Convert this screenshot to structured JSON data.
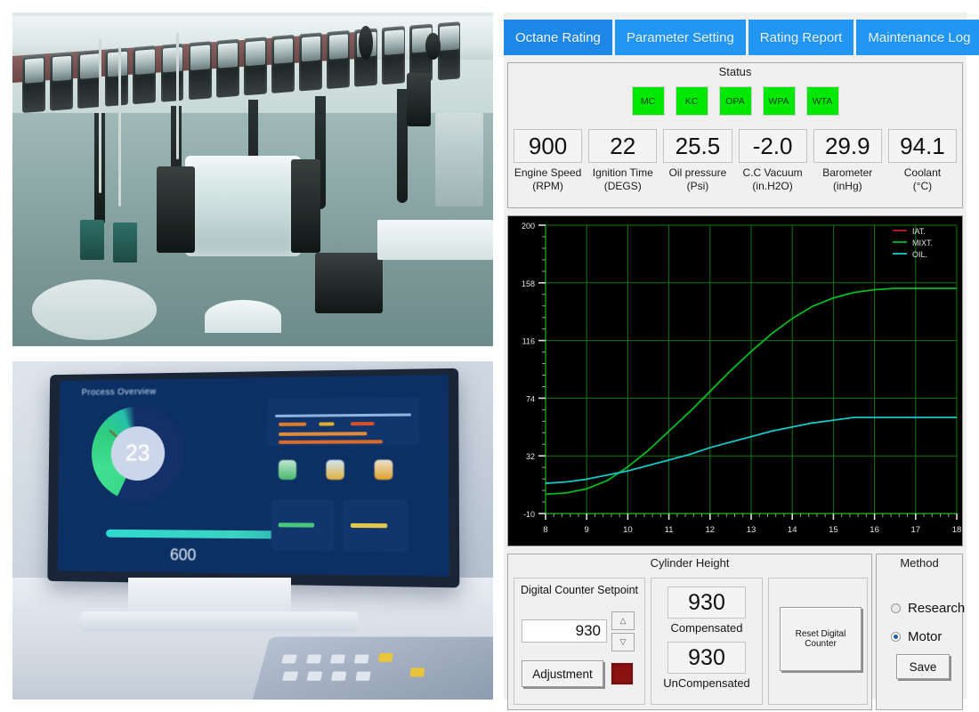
{
  "app": {
    "tabs": [
      {
        "label": "Octane Rating",
        "selected": true
      },
      {
        "label": "Parameter Setting",
        "selected": false
      },
      {
        "label": "Rating Report",
        "selected": false
      },
      {
        "label": "Maintenance Log",
        "selected": false
      }
    ],
    "accent_color": "#2196f3",
    "accent_selected_color": "#1e88e8"
  },
  "status": {
    "title": "Status",
    "led_color": "#00e800",
    "leds": [
      {
        "label": "MC"
      },
      {
        "label": "KC"
      },
      {
        "label": "OPA"
      },
      {
        "label": "WPA"
      },
      {
        "label": "WTA"
      }
    ],
    "meters": [
      {
        "value": "900",
        "name": "Engine Speed",
        "unit": "(RPM)"
      },
      {
        "value": "22",
        "name": "Ignition Time",
        "unit": "(DEGS)"
      },
      {
        "value": "25.5",
        "name": "Oil pressure",
        "unit": "(Psi)"
      },
      {
        "value": "-2.0",
        "name": "C.C Vacuum",
        "unit": "(in.H2O)"
      },
      {
        "value": "29.9",
        "name": "Barometer",
        "unit": "(inHg)"
      },
      {
        "value": "94.1",
        "name": "Coolant",
        "unit": "(°C)"
      }
    ]
  },
  "chart_data": {
    "type": "line",
    "title": "",
    "xlabel": "",
    "ylabel": "",
    "background": "#000000",
    "grid": true,
    "grid_color": "#0a7a0a",
    "legend_position": "top-right",
    "xlim": [
      8,
      18
    ],
    "ylim": [
      -10,
      200
    ],
    "xticks": [
      8,
      9,
      10,
      11,
      12,
      13,
      14,
      15,
      16,
      17,
      18
    ],
    "yticks": [
      -10,
      32,
      74,
      116,
      158,
      200
    ],
    "x": [
      8,
      8.5,
      9,
      9.5,
      10,
      10.5,
      11,
      11.5,
      12,
      12.5,
      13,
      13.5,
      14,
      14.5,
      15,
      15.5,
      16,
      16.5,
      17,
      17.5,
      18
    ],
    "series": [
      {
        "name": "IAT.",
        "color": "#c02020",
        "values": [
          null,
          null,
          null,
          null,
          null,
          null,
          null,
          null,
          null,
          null,
          null,
          null,
          null,
          null,
          null,
          null,
          null,
          null,
          null,
          null,
          null
        ]
      },
      {
        "name": "MIXT.",
        "color": "#00bb22",
        "values": [
          4,
          5,
          8,
          14,
          24,
          36,
          50,
          64,
          79,
          94,
          108,
          121,
          132,
          141,
          147,
          151,
          153,
          154,
          154,
          154,
          154
        ]
      },
      {
        "name": "OIL.",
        "color": "#14c8c8",
        "values": [
          12,
          13,
          15,
          18,
          21,
          25,
          29,
          33,
          38,
          42,
          46,
          50,
          53,
          56,
          58,
          60,
          60,
          60,
          60,
          60,
          60
        ]
      }
    ]
  },
  "cylinder_height": {
    "title": "Cylinder Height",
    "setpoint_label": "Digital Counter Setpoint",
    "setpoint_value": "930",
    "spin_up_icon": "triangle-up-icon",
    "spin_down_icon": "triangle-down-icon",
    "adjustment_label": "Adjustment",
    "indicator_color": "#8c1212",
    "compensated_value": "930",
    "compensated_label": "Compensated",
    "uncompensated_value": "930",
    "uncompensated_label": "UnCompensated",
    "reset_label": "Reset Digital Counter"
  },
  "method": {
    "title": "Method",
    "options": [
      {
        "label": "Research",
        "selected": false
      },
      {
        "label": "Motor",
        "selected": true
      }
    ],
    "save_label": "Save"
  },
  "photos": {
    "machine": {
      "caption": "industrial-machine-photo"
    },
    "dashboard": {
      "caption": "control-dashboard-monitor-photo",
      "gauge_value": "23",
      "readout_value": "600"
    }
  }
}
